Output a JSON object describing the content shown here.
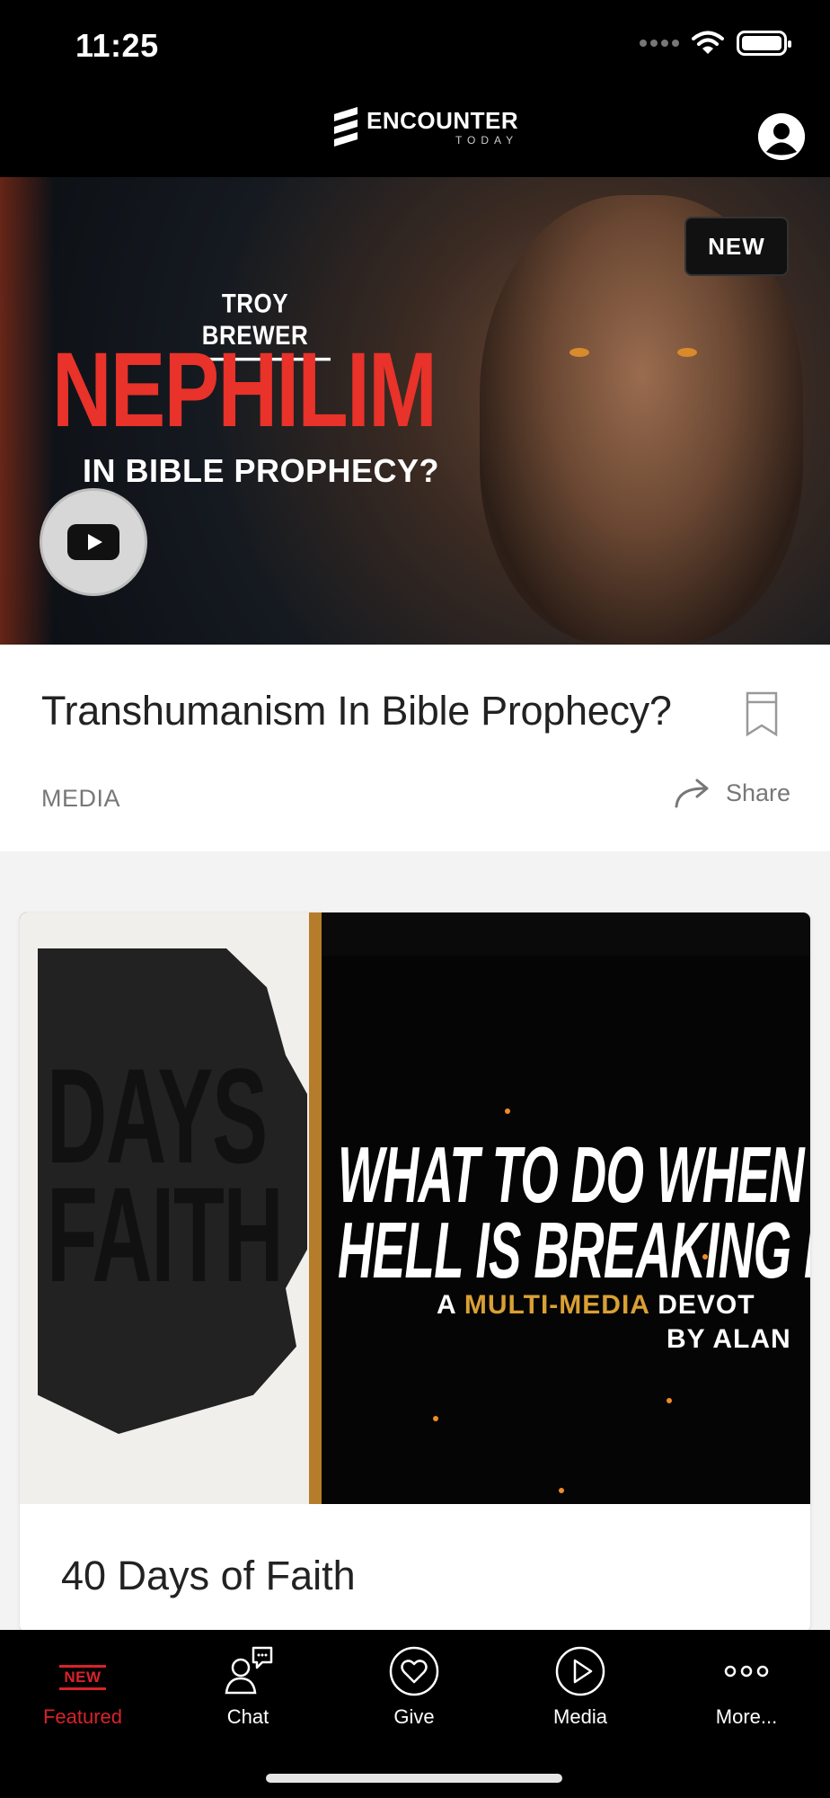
{
  "status_bar": {
    "time": "11:25"
  },
  "header": {
    "logo_text": "ENCOUNTER",
    "logo_sub": "TODAY"
  },
  "hero": {
    "author": "TROY BREWER",
    "title": "NEPHILIM",
    "subtitle": "IN BIBLE PROPHECY?",
    "badge": "NEW"
  },
  "feature": {
    "title": "Transhumanism In Bible Prophecy?",
    "category": "MEDIA",
    "share_label": "Share"
  },
  "card": {
    "image_left_lines": [
      "DAYS",
      "FAITH"
    ],
    "image_headline_lines": [
      "WHAT TO DO WHEN A",
      "HELL IS BREAKING LO"
    ],
    "image_tagline_prefix": "A ",
    "image_tagline_highlight": "MULTI-MEDIA",
    "image_tagline_suffix": " DEVOT",
    "image_byline": "BY ALAN",
    "title": "40 Days of Faith"
  },
  "tabs": [
    {
      "label": "Featured",
      "icon": "new-badge-icon",
      "icon_text": "NEW",
      "active": true
    },
    {
      "label": "Chat",
      "icon": "chat-person-icon",
      "active": false
    },
    {
      "label": "Give",
      "icon": "heart-circle-icon",
      "active": false
    },
    {
      "label": "Media",
      "icon": "play-circle-icon",
      "active": false
    },
    {
      "label": "More...",
      "icon": "more-dots-icon",
      "active": false
    }
  ],
  "colors": {
    "accent": "#d8232a",
    "hero_red": "#e8322a",
    "gold": "#d9a033"
  }
}
